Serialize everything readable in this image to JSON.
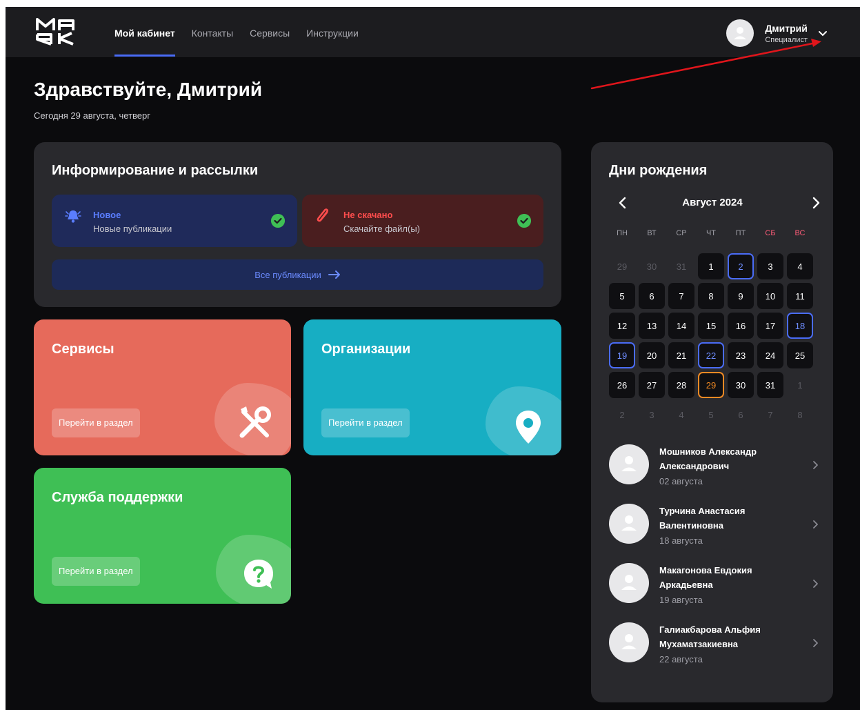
{
  "header": {
    "nav": [
      {
        "label": "Мой кабинет",
        "active": true
      },
      {
        "label": "Контакты",
        "active": false
      },
      {
        "label": "Сервисы",
        "active": false
      },
      {
        "label": "Инструкции",
        "active": false
      }
    ],
    "user": {
      "name": "Дмитрий",
      "role": "Специалист"
    }
  },
  "greeting": {
    "title": "Здравствуйте, Дмитрий",
    "date": "Сегодня 29 августа, четверг"
  },
  "info": {
    "title": "Информирование и рассылки",
    "tiles": [
      {
        "title": "Новое",
        "subtitle": "Новые публикации",
        "icon": "bell-icon"
      },
      {
        "title": "Не скачано",
        "subtitle": "Скачайте файл(ы)",
        "icon": "paperclip-icon"
      }
    ],
    "all_label": "Все публикации"
  },
  "sections": {
    "services": {
      "title": "Сервисы",
      "button": "Перейти в раздел",
      "icon": "tools-icon"
    },
    "orgs": {
      "title": "Организации",
      "button": "Перейти в раздел",
      "icon": "location-pin-icon"
    },
    "support": {
      "title": "Служба поддержки",
      "button": "Перейти в раздел",
      "icon": "question-bubble-icon"
    }
  },
  "birthdays": {
    "title": "Дни рождения",
    "month": "Август 2024",
    "weekdays": [
      "ПН",
      "ВТ",
      "СР",
      "ЧТ",
      "ПТ",
      "СБ",
      "ВС"
    ],
    "days": [
      {
        "d": "29",
        "muted": true
      },
      {
        "d": "30",
        "muted": true
      },
      {
        "d": "31",
        "muted": true
      },
      {
        "d": "1"
      },
      {
        "d": "2",
        "hl": "blue"
      },
      {
        "d": "3"
      },
      {
        "d": "4"
      },
      {
        "d": "5"
      },
      {
        "d": "6"
      },
      {
        "d": "7"
      },
      {
        "d": "8"
      },
      {
        "d": "9"
      },
      {
        "d": "10"
      },
      {
        "d": "11"
      },
      {
        "d": "12"
      },
      {
        "d": "13"
      },
      {
        "d": "14"
      },
      {
        "d": "15"
      },
      {
        "d": "16"
      },
      {
        "d": "17"
      },
      {
        "d": "18",
        "hl": "blue"
      },
      {
        "d": "19",
        "hl": "blue"
      },
      {
        "d": "20"
      },
      {
        "d": "21"
      },
      {
        "d": "22",
        "hl": "blue"
      },
      {
        "d": "23"
      },
      {
        "d": "24"
      },
      {
        "d": "25"
      },
      {
        "d": "26"
      },
      {
        "d": "27"
      },
      {
        "d": "28"
      },
      {
        "d": "29",
        "hl": "orange"
      },
      {
        "d": "30"
      },
      {
        "d": "31"
      },
      {
        "d": "1",
        "muted": true
      },
      {
        "d": "2",
        "muted": true
      },
      {
        "d": "3",
        "muted": true
      },
      {
        "d": "4",
        "muted": true
      },
      {
        "d": "5",
        "muted": true
      },
      {
        "d": "6",
        "muted": true
      },
      {
        "d": "7",
        "muted": true
      },
      {
        "d": "8",
        "muted": true
      }
    ],
    "people": [
      {
        "name": "Мошников Александр Александрович",
        "date": "02 августа"
      },
      {
        "name": "Турчина Анастасия Валентиновна",
        "date": "18 августа"
      },
      {
        "name": "Макагонова Евдокия Аркадьевна",
        "date": "19 августа"
      },
      {
        "name": "Галиакбарова Альфия Мухаматзакиевна",
        "date": "22 августа"
      }
    ]
  },
  "colors": {
    "accent": "#4a6cf7",
    "services": "#e66a5b",
    "orgs": "#17aec3",
    "support": "#3fbf55",
    "today": "#f08a24",
    "annotation": "#e0151b"
  }
}
